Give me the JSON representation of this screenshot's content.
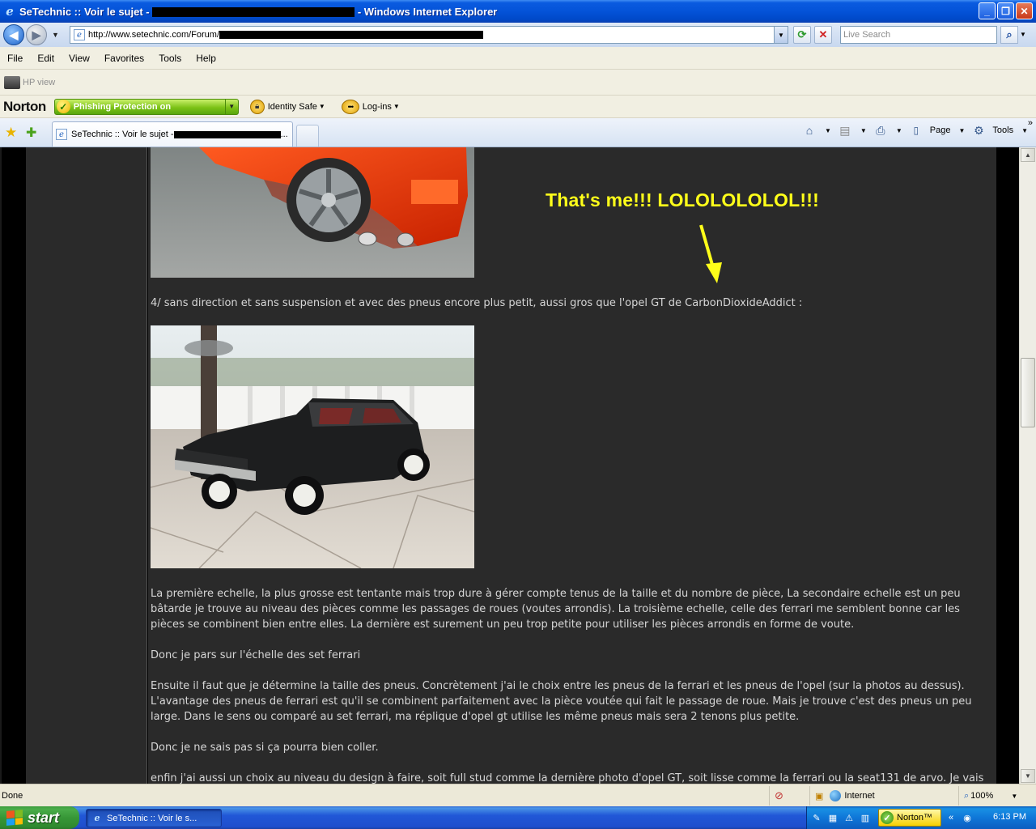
{
  "window": {
    "title_prefix": "SeTechnic :: Voir le sujet - ",
    "title_suffix": " - Windows Internet Explorer",
    "minimize": "_",
    "maximize": "❐",
    "close": "✕"
  },
  "address": {
    "url": "http://www.setechnic.com/Forum/",
    "search_placeholder": "Live Search"
  },
  "menu": [
    "File",
    "Edit",
    "View",
    "Favorites",
    "Tools",
    "Help"
  ],
  "hp_toolbar": {
    "label": "HP view"
  },
  "norton_toolbar": {
    "logo": "Norton",
    "phishing": "Phishing Protection on",
    "identity_safe": "Identity Safe",
    "logins": "Log-ins",
    "logins_dots": "•••"
  },
  "tabs": [
    {
      "label": "SeTechnic :: Voir le sujet - "
    }
  ],
  "command_bar": {
    "page": "Page",
    "tools": "Tools"
  },
  "content": {
    "annotation": "That's me!!! LOLOLOLOLOL!!!",
    "line_4": "4/ sans direction et sans suspension et avec des pneus encore plus petit, aussi gros que l'opel GT de CarbonDioxideAddict :",
    "para_1": "La première echelle, la plus grosse est tentante mais trop dure à gérer compte tenus de la taille et du nombre de pièce, La secondaire echelle est un peu bâtarde je trouve au niveau des pièces comme les passages de roues (voutes arrondis). La troisième echelle, celle des ferrari me semblent bonne car les pièces se combinent bien entre elles. La dernière est surement un peu trop petite pour utiliser les pièces arrondis en forme de voute.",
    "para_2": "Donc je pars sur l'échelle des set ferrari",
    "para_3": "Ensuite il faut que je détermine la taille des pneus. Concrètement j'ai le choix entre les pneus de la ferrari et les pneus de l'opel (sur la photos au dessus). L'avantage des pneus de ferrari est qu'il se combinent parfaitement avec la pièce voutée qui fait le passage de roue. Mais je trouve c'est des pneus un peu large. Dans le sens ou comparé au set ferrari, ma réplique d'opel gt utilise les même pneus mais sera 2 tenons plus petite.",
    "para_4": "Donc je ne sais pas si ça pourra bien coller.",
    "para_5": "enfin j'ai aussi un choix au niveau du design à faire, soit full stud comme la dernière photo d'opel GT, soit lisse comme la ferrari ou la seat131 de arvo. Je vais"
  },
  "status": {
    "text": "Done",
    "zone": "Internet",
    "zoom": "100%"
  },
  "taskbar": {
    "start": "start",
    "task_item": "SeTechnic :: Voir le s...",
    "norton": "Norton™",
    "clock": "6:13 PM"
  },
  "colors": {
    "annotation": "#ffff1a",
    "content_bg": "#2a2a2a",
    "text": "#d6d6d6"
  }
}
